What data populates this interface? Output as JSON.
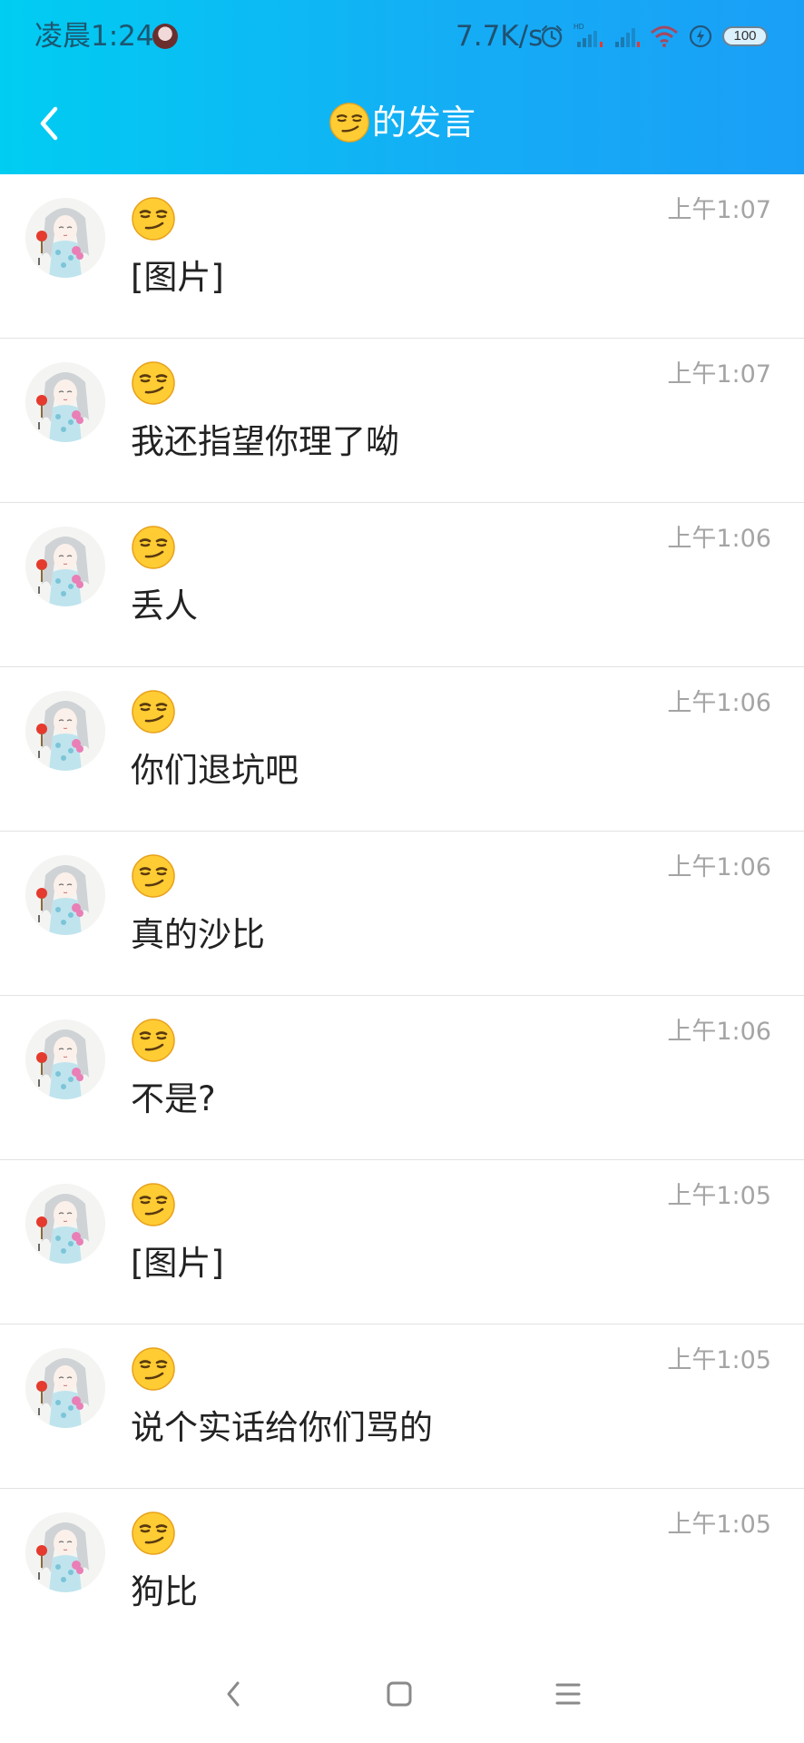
{
  "status_bar": {
    "time": "凌晨1:24",
    "net_speed": "7.7K/s",
    "battery": "100",
    "icons": [
      "alarm-icon",
      "hd-signal-icon",
      "signal-icon",
      "wifi-icon",
      "charging-icon",
      "battery-icon"
    ]
  },
  "header": {
    "back_icon": "chevron-left-icon",
    "title_emoji": "smirk-emoji",
    "title": "的发言",
    "colors": {
      "gradient_start": "#00cdf2",
      "gradient_end": "#1a9ff7"
    }
  },
  "messages": [
    {
      "sender": "smirk-emoji",
      "time": "上午1:07",
      "text": "[图片]"
    },
    {
      "sender": "smirk-emoji",
      "time": "上午1:07",
      "text": "我还指望你理了呦"
    },
    {
      "sender": "smirk-emoji",
      "time": "上午1:06",
      "text": "丢人"
    },
    {
      "sender": "smirk-emoji",
      "time": "上午1:06",
      "text": "你们退坑吧"
    },
    {
      "sender": "smirk-emoji",
      "time": "上午1:06",
      "text": "真的沙比"
    },
    {
      "sender": "smirk-emoji",
      "time": "上午1:06",
      "text": "不是?"
    },
    {
      "sender": "smirk-emoji",
      "time": "上午1:05",
      "text": "[图片]"
    },
    {
      "sender": "smirk-emoji",
      "time": "上午1:05",
      "text": "说个实话给你们骂的"
    },
    {
      "sender": "smirk-emoji",
      "time": "上午1:05",
      "text": "狗比"
    }
  ],
  "system_nav": {
    "icons": [
      "back-nav-icon",
      "home-nav-icon",
      "menu-nav-icon"
    ]
  }
}
